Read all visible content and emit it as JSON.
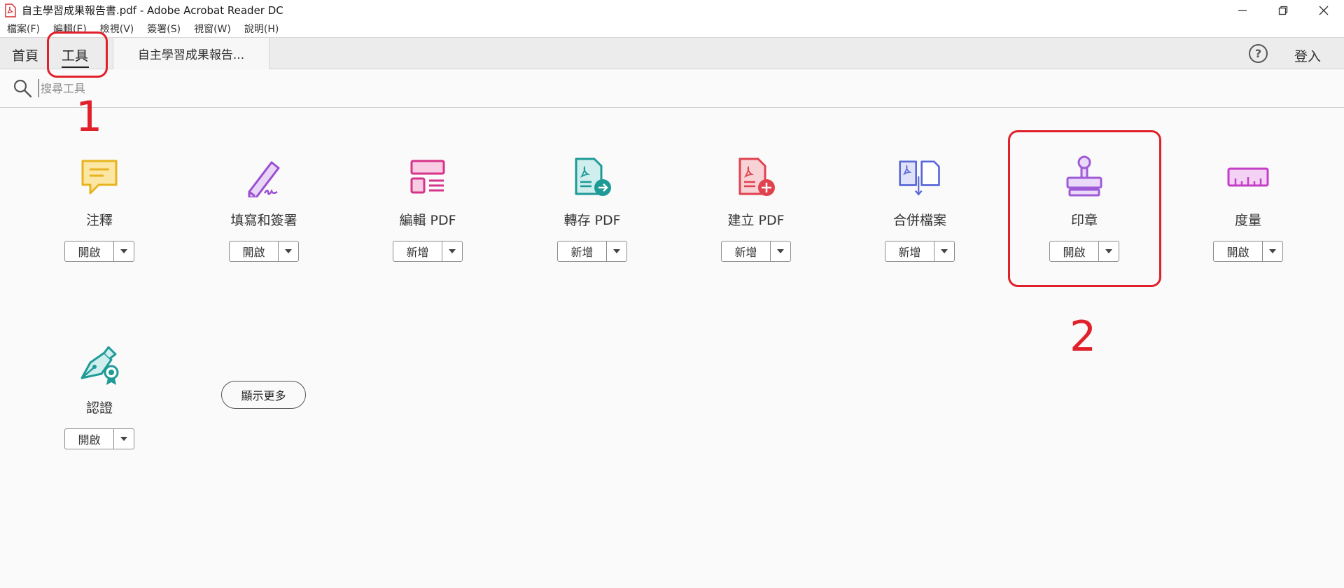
{
  "window": {
    "title": "自主學習成果報告書.pdf - Adobe Acrobat Reader DC"
  },
  "menu": [
    "檔案(F)",
    "編輯(E)",
    "檢視(V)",
    "簽署(S)",
    "視窗(W)",
    "說明(H)"
  ],
  "tabs": {
    "home": "首頁",
    "tools": "工具",
    "document": "自主學習成果報告...",
    "help": "?",
    "signin": "登入"
  },
  "search": {
    "placeholder": "搜尋工具"
  },
  "tools": [
    {
      "label": "注釋",
      "action": "開啟",
      "icon": "comment-icon",
      "color": "#e8b320"
    },
    {
      "label": "填寫和簽署",
      "action": "開啟",
      "icon": "fill-sign-icon",
      "color": "#9b4fd0"
    },
    {
      "label": "編輯 PDF",
      "action": "新增",
      "icon": "edit-pdf-icon",
      "color": "#d6338a"
    },
    {
      "label": "轉存 PDF",
      "action": "新增",
      "icon": "export-pdf-icon",
      "color": "#1f9b97"
    },
    {
      "label": "建立 PDF",
      "action": "新增",
      "icon": "create-pdf-icon",
      "color": "#e0424e"
    },
    {
      "label": "合併檔案",
      "action": "新增",
      "icon": "combine-files-icon",
      "color": "#5a68d8"
    },
    {
      "label": "印章",
      "action": "開啟",
      "icon": "stamp-icon",
      "color": "#9f5bd6"
    },
    {
      "label": "度量",
      "action": "開啟",
      "icon": "measure-icon",
      "color": "#c43fc7"
    },
    {
      "label": "認證",
      "action": "開啟",
      "icon": "certificate-icon",
      "color": "#1f9b97"
    }
  ],
  "show_more": "顯示更多",
  "annotations": {
    "step1": "1",
    "step2": "2",
    "color": "#e0202a"
  }
}
